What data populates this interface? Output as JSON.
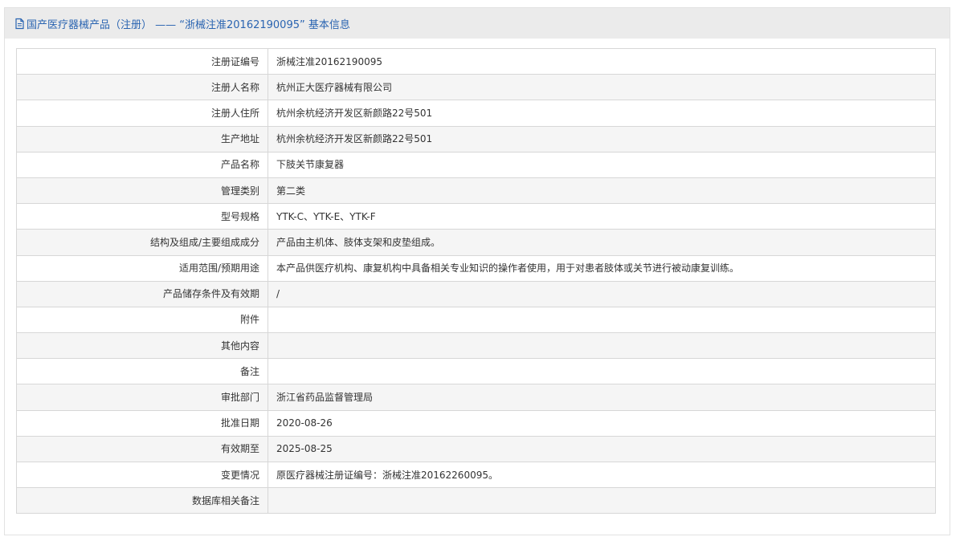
{
  "header": {
    "icon": "document-icon",
    "title": "国产医疗器械产品（注册） —— “浙械注准20162190095” 基本信息"
  },
  "rows": [
    {
      "label": "注册证编号",
      "value": "浙械注准20162190095"
    },
    {
      "label": "注册人名称",
      "value": "杭州正大医疗器械有限公司"
    },
    {
      "label": "注册人住所",
      "value": "杭州余杭经济开发区新颜路22号501"
    },
    {
      "label": "生产地址",
      "value": "杭州余杭经济开发区新颜路22号501"
    },
    {
      "label": "产品名称",
      "value": "下肢关节康复器"
    },
    {
      "label": "管理类别",
      "value": "第二类"
    },
    {
      "label": "型号规格",
      "value": "YTK-C、YTK-E、YTK-F"
    },
    {
      "label": "结构及组成/主要组成成分",
      "value": "产品由主机体、肢体支架和皮垫组成。"
    },
    {
      "label": "适用范围/预期用途",
      "value": "本产品供医疗机构、康复机构中具备相关专业知识的操作者使用，用于对患者肢体或关节进行被动康复训练。"
    },
    {
      "label": "产品储存条件及有效期",
      "value": "/"
    },
    {
      "label": "附件",
      "value": ""
    },
    {
      "label": "其他内容",
      "value": ""
    },
    {
      "label": "备注",
      "value": ""
    },
    {
      "label": "审批部门",
      "value": "浙江省药品监督管理局"
    },
    {
      "label": "批准日期",
      "value": "2020-08-26"
    },
    {
      "label": "有效期至",
      "value": "2025-08-25"
    },
    {
      "label": "变更情况",
      "value": "原医疗器械注册证编号：浙械注准20162260095。"
    },
    {
      "label": "数据库相关备注",
      "value": ""
    }
  ]
}
